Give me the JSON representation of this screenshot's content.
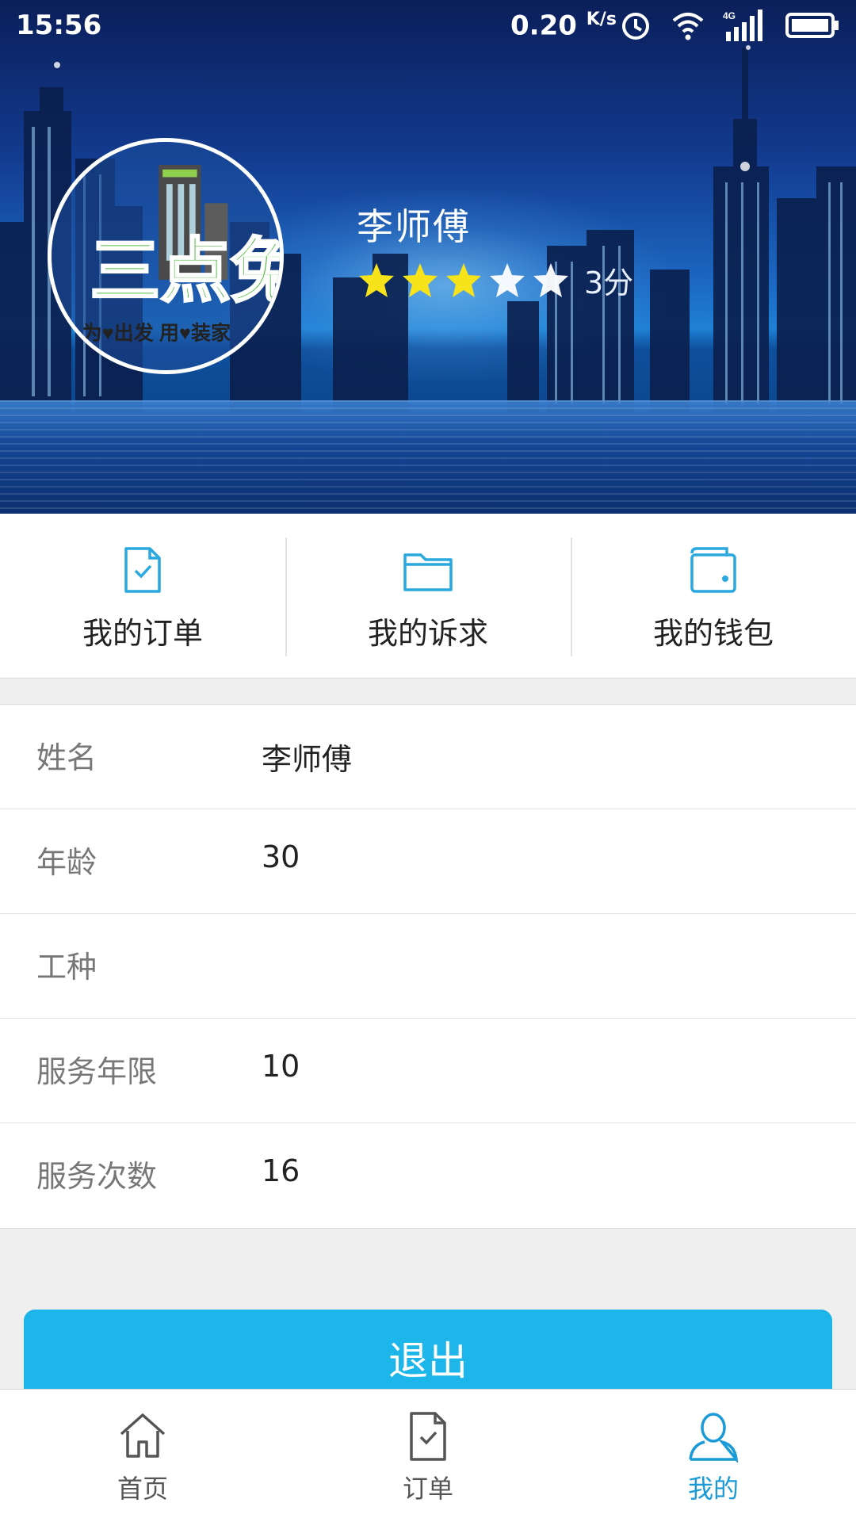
{
  "status_bar": {
    "time": "15:56",
    "net_speed": "0.20",
    "net_speed_unit": "K/s",
    "network_type": "4G",
    "icons": [
      "alarm-icon",
      "wifi-icon",
      "signal-icon",
      "battery-icon"
    ]
  },
  "profile": {
    "name": "李师傅",
    "rating": 3,
    "rating_max": 5,
    "score_text": "3分",
    "avatar_logo": {
      "main_text": "三点兔",
      "slogan": "为♥出发 用♥装家"
    }
  },
  "quick_menu": [
    {
      "label": "我的订单",
      "icon": "order-document-icon"
    },
    {
      "label": "我的诉求",
      "icon": "folder-icon"
    },
    {
      "label": "我的钱包",
      "icon": "wallet-icon"
    }
  ],
  "info": {
    "name_label": "姓名",
    "name_value": "李师傅",
    "age_label": "年龄",
    "age_value": "30",
    "trade_label": "工种",
    "trade_value": "",
    "years_label": "服务年限",
    "years_value": "10",
    "count_label": "服务次数",
    "count_value": "16"
  },
  "logout_label": "退出",
  "tabbar": {
    "home": "首页",
    "orders": "订单",
    "mine": "我的",
    "active": "mine"
  },
  "colors": {
    "accent": "#1cb6ea",
    "tab_active": "#1a9ad6",
    "icon_blue": "#29a9df",
    "star_yellow": "#f7e31a"
  }
}
